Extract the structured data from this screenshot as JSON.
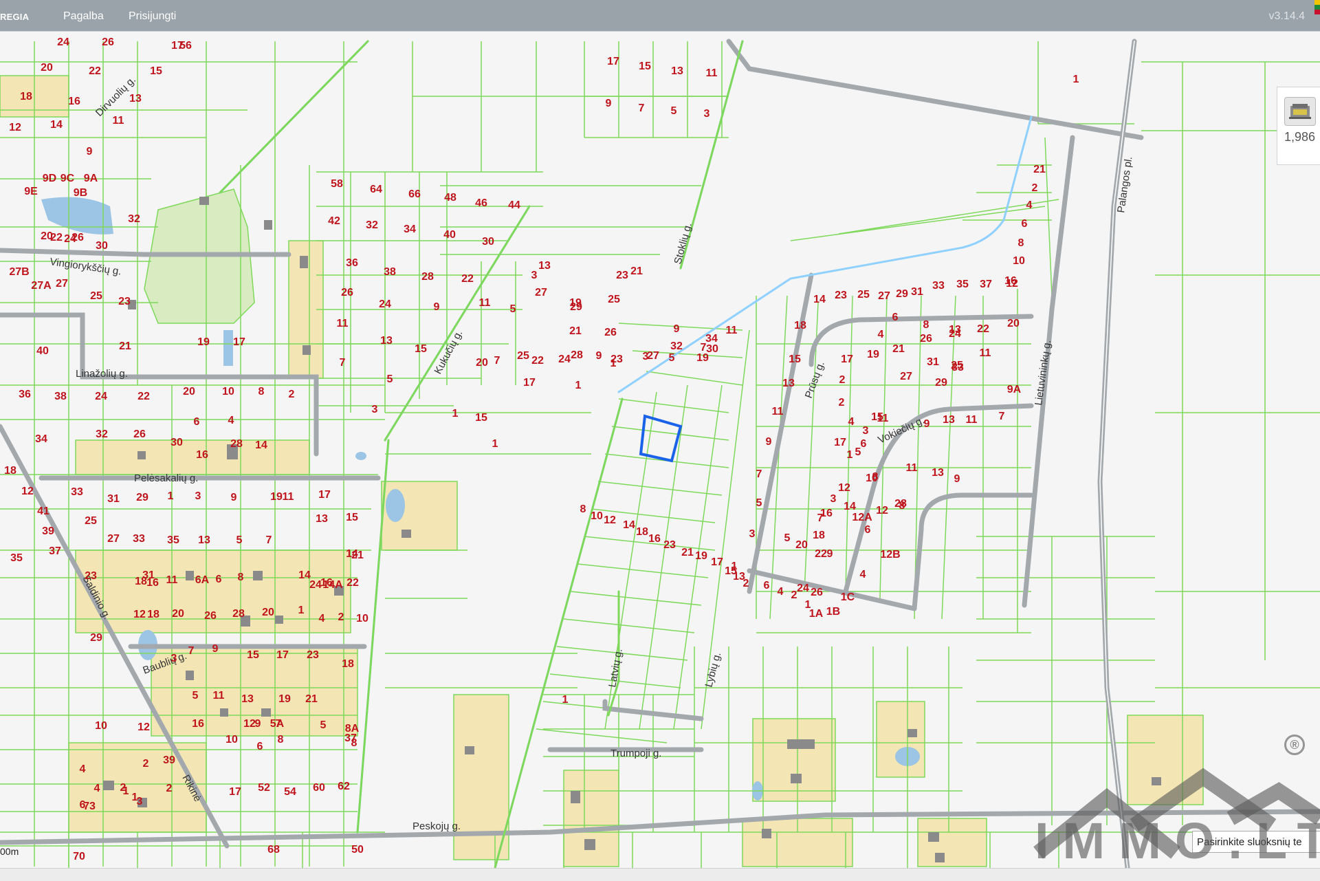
{
  "topbar": {
    "brand": "REGIA",
    "menu": [
      "Pagalba",
      "Prisijungti"
    ],
    "version": "v3.14.4"
  },
  "map_controls": {
    "layer_button_icon": "map-layers-icon",
    "scale_ratio": "1,986",
    "layer_select_placeholder": "Pasirinkite sluoksnių te",
    "scale_bar": "00m"
  },
  "watermark": {
    "text": "IMMO.LT",
    "mark": "®"
  },
  "colors": {
    "parcel_border": "#7ed85a",
    "road": "#a3a8ad",
    "road_outline": "#8fd0ff",
    "building": "#8a8a8a",
    "yard": "#f3e6b4",
    "park": "#d9ebc1",
    "water": "#9cc4e4",
    "selection": "#1a63e8",
    "label": "#c0141d"
  },
  "streets": [
    "Dirvuolių g.",
    "Vingiorykščių g.",
    "Linažolių g.",
    "Pelėsakalių g.",
    "Saldinio g.",
    "Baublių g.",
    "Rikinė",
    "Kukučių g.",
    "Stoklių g.",
    "Prūsų g.",
    "Lietuvininkų g.",
    "Vokiečių g.",
    "Latvių g.",
    "Lybių g.",
    "Trumpoji g.",
    "Peskojų g.",
    "Palangos pl."
  ],
  "parcel_numbers": [
    "24",
    "26",
    "17",
    "20",
    "22",
    "15",
    "18",
    "16",
    "13",
    "12",
    "14",
    "11",
    "9",
    "9D",
    "9C",
    "9A",
    "9E",
    "9B",
    "32",
    "20",
    "24",
    "22",
    "26",
    "30",
    "27B",
    "27A",
    "27",
    "25",
    "23",
    "40",
    "21",
    "19",
    "17",
    "36",
    "38",
    "24",
    "22",
    "20",
    "10",
    "8",
    "2",
    "34",
    "32",
    "26",
    "30",
    "28",
    "16",
    "14",
    "6",
    "4",
    "18",
    "12",
    "41",
    "39",
    "37",
    "35",
    "33",
    "31",
    "29",
    "1",
    "3",
    "9",
    "11",
    "17",
    "19",
    "25",
    "27",
    "33",
    "35",
    "13",
    "5",
    "7",
    "13",
    "15",
    "21",
    "23",
    "29",
    "31",
    "18",
    "16",
    "11",
    "6A",
    "6",
    "8",
    "14",
    "16",
    "22",
    "24",
    "14A",
    "14",
    "4",
    "2",
    "10",
    "12",
    "18",
    "20",
    "26",
    "28",
    "20",
    "1",
    "7",
    "9",
    "15",
    "17",
    "23",
    "18",
    "3",
    "5",
    "11",
    "13",
    "19",
    "21",
    "16",
    "12",
    "9",
    "7",
    "5A",
    "5",
    "8A",
    "8",
    "10",
    "12",
    "10",
    "6",
    "8",
    "37",
    "4",
    "2",
    "39",
    "1",
    "3",
    "6",
    "4",
    "2",
    "73",
    "1",
    "2",
    "17",
    "52",
    "54",
    "60",
    "62",
    "70",
    "68",
    "50",
    "56",
    "58",
    "64",
    "66",
    "48",
    "46",
    "44",
    "42",
    "32",
    "34",
    "40",
    "30",
    "36",
    "38",
    "28",
    "22",
    "26",
    "24",
    "9",
    "11",
    "13",
    "15",
    "7",
    "5",
    "3",
    "1",
    "1",
    "15",
    "17",
    "29",
    "3",
    "13",
    "19",
    "27",
    "5",
    "11",
    "21",
    "25",
    "7",
    "9",
    "23",
    "27",
    "25",
    "23",
    "21",
    "28",
    "30",
    "32",
    "34",
    "26",
    "24",
    "22",
    "20",
    "1",
    "1",
    "3",
    "5",
    "7",
    "9",
    "11",
    "19",
    "17",
    "15",
    "13",
    "11",
    "9",
    "7",
    "5",
    "3",
    "1",
    "21",
    "2",
    "4",
    "6",
    "8",
    "10",
    "12",
    "14",
    "23",
    "25",
    "27",
    "29",
    "31",
    "33",
    "35",
    "37",
    "16",
    "18",
    "20",
    "22",
    "24",
    "26",
    "21",
    "19",
    "17",
    "15",
    "13",
    "11",
    "9",
    "7",
    "5",
    "3",
    "1",
    "2",
    "4",
    "6",
    "8",
    "10",
    "12",
    "14",
    "16",
    "18",
    "20",
    "22",
    "24",
    "26",
    "9",
    "7",
    "5",
    "3",
    "1",
    "11",
    "29",
    "27",
    "31",
    "25",
    "33",
    "11",
    "13",
    "8",
    "6",
    "4",
    "2",
    "17",
    "3",
    "5",
    "15",
    "9",
    "13",
    "11",
    "7",
    "9A",
    "9",
    "13",
    "11",
    "28",
    "12",
    "12A",
    "12B",
    "8",
    "6",
    "4",
    "1C",
    "1B",
    "1A",
    "1",
    "2",
    "4",
    "6",
    "2",
    "13",
    "15",
    "17",
    "19",
    "21",
    "23",
    "16",
    "18",
    "14",
    "12",
    "10",
    "8",
    "1"
  ]
}
